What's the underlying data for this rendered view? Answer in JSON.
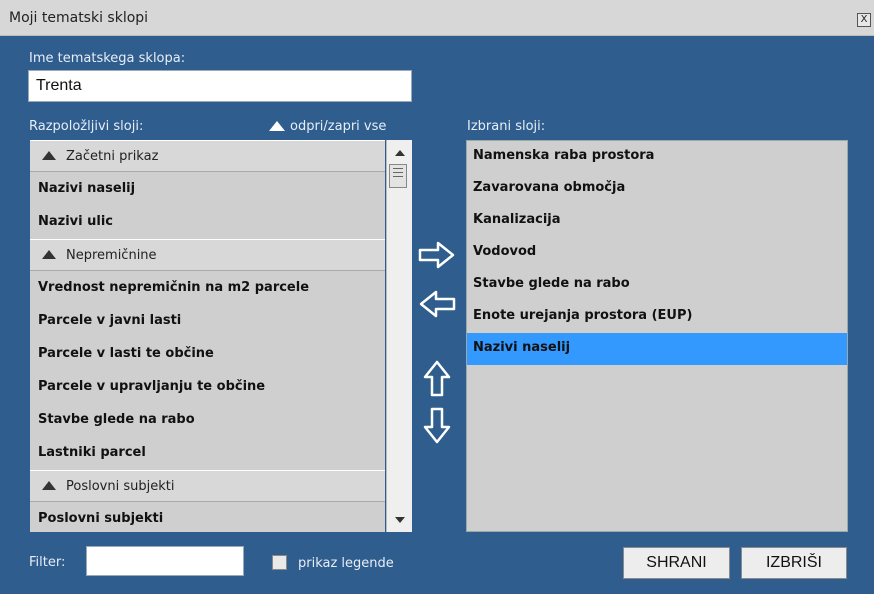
{
  "window": {
    "title": "Moji tematski sklopi",
    "close_label": "X"
  },
  "name_field": {
    "label": "Ime tematskega sklopa:",
    "value": "Trenta"
  },
  "available": {
    "label": "Razpoložljivi sloji:",
    "toggle_all": "odpri/zapri vse",
    "rows": [
      {
        "type": "group",
        "label": "Začetni prikaz"
      },
      {
        "type": "item",
        "label": "Nazivi naselij"
      },
      {
        "type": "item",
        "label": "Nazivi ulic"
      },
      {
        "type": "group",
        "label": "Nepremičnine"
      },
      {
        "type": "item",
        "label": "Vrednost nepremičnin na m2 parcele"
      },
      {
        "type": "item",
        "label": "Parcele v javni lasti"
      },
      {
        "type": "item",
        "label": "Parcele v lasti te občine"
      },
      {
        "type": "item",
        "label": "Parcele v upravljanju te občine"
      },
      {
        "type": "item",
        "label": "Stavbe glede na rabo"
      },
      {
        "type": "item",
        "label": "Lastniki parcel"
      },
      {
        "type": "group",
        "label": "Poslovni subjekti"
      },
      {
        "type": "item",
        "label": "Poslovni subjekti"
      }
    ]
  },
  "selected": {
    "label": "Izbrani sloji:",
    "items": [
      "Namenska raba prostora",
      "Zavarovana območja",
      "Kanalizacija",
      "Vodovod",
      "Stavbe glede na rabo",
      "Enote urejanja prostora (EUP)",
      "Nazivi naselij"
    ],
    "selected_index": 6
  },
  "footer": {
    "filter_label": "Filter:",
    "filter_value": "",
    "legend_label": "prikaz legende",
    "legend_checked": false,
    "save_label": "SHRANI",
    "delete_label": "IZBRIŠI"
  },
  "colors": {
    "background": "#2e5d8e",
    "list": "#cfcfcf",
    "selection": "#3399ff"
  }
}
